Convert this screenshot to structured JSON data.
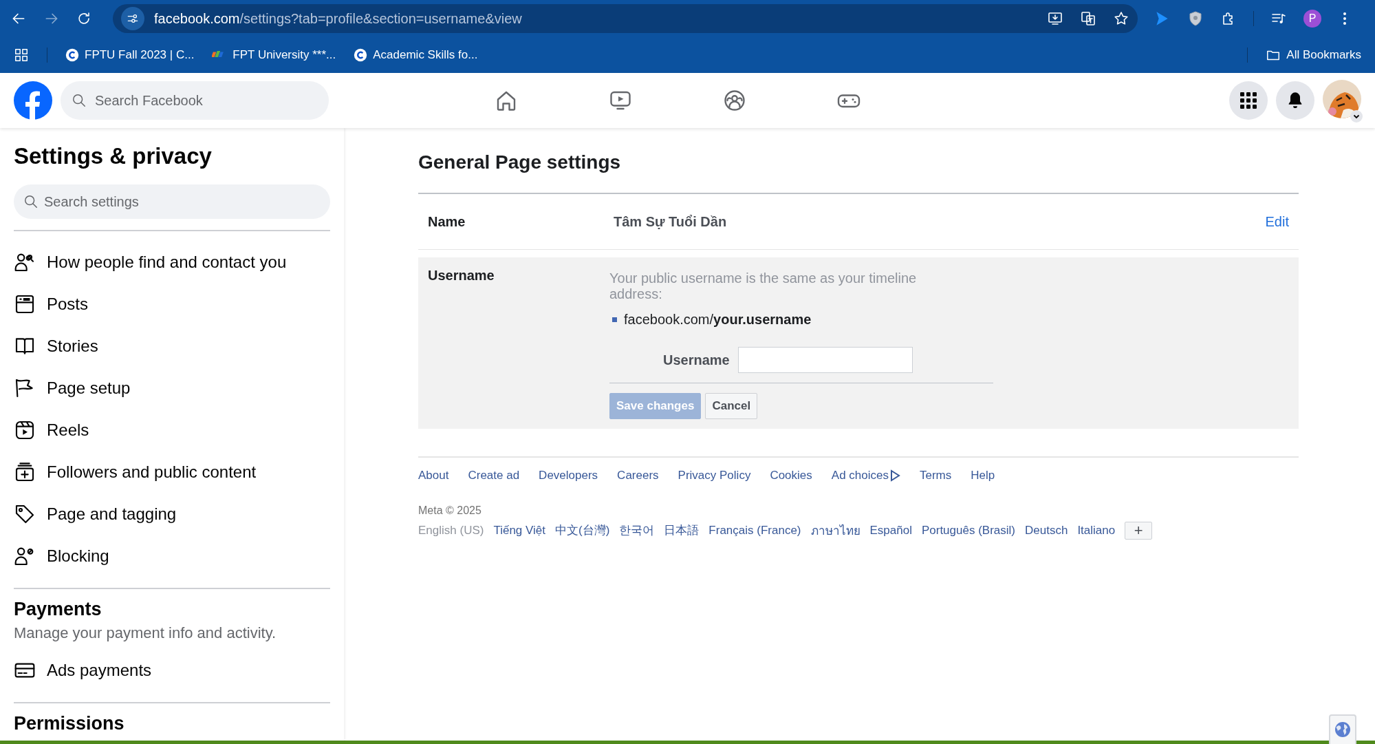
{
  "browser": {
    "url": {
      "domain": "facebook.com",
      "path": "/settings?tab=profile&section=username&view"
    },
    "bookmarks": [
      {
        "label": "FPTU Fall 2023 | C...",
        "kind": "c"
      },
      {
        "label": "FPT University ***...",
        "kind": "fpt"
      },
      {
        "label": "Academic Skills fo...",
        "kind": "c"
      }
    ],
    "all_bookmarks": "All Bookmarks",
    "profile_letter": "P"
  },
  "header": {
    "search": {
      "placeholder": "Search Facebook"
    }
  },
  "sidebar": {
    "title": "Settings & privacy",
    "search": {
      "placeholder": "Search settings"
    },
    "items": [
      {
        "label": "How people find and contact you",
        "kind": "people"
      },
      {
        "label": "Posts",
        "kind": "posts"
      },
      {
        "label": "Stories",
        "kind": "book"
      },
      {
        "label": "Page setup",
        "kind": "flag"
      },
      {
        "label": "Reels",
        "kind": "reels"
      },
      {
        "label": "Followers and public content",
        "kind": "followers"
      },
      {
        "label": "Page and tagging",
        "kind": "tag"
      },
      {
        "label": "Blocking",
        "kind": "block"
      }
    ],
    "sections": [
      {
        "title": "Payments",
        "description": "Manage your payment info and activity.",
        "items": [
          {
            "label": "Ads payments",
            "kind": "card"
          }
        ]
      },
      {
        "title": "Permissions"
      }
    ]
  },
  "main": {
    "title": "General Page settings",
    "name_row": {
      "label": "Name",
      "value": "Tâm Sự Tuổi Dần",
      "action": "Edit"
    },
    "username_row": {
      "label": "Username",
      "description": "Your public username is the same as your timeline address:",
      "example": "facebook.com/**your.username**",
      "field_label": "Username",
      "buttons": [
        {
          "label": "Save changes",
          "kind": "primary",
          "disabled": true
        },
        {
          "label": "Cancel",
          "kind": "secondary",
          "disabled": false
        }
      ]
    }
  },
  "footer": {
    "links": [
      {
        "label": "About",
        "kind": "text"
      },
      {
        "label": "Create ad",
        "kind": "text"
      },
      {
        "label": "Developers",
        "kind": "text"
      },
      {
        "label": "Careers",
        "kind": "text"
      },
      {
        "label": "Privacy Policy",
        "kind": "text"
      },
      {
        "label": "Cookies",
        "kind": "text"
      },
      {
        "label": "Ad choices",
        "kind": "adchoices"
      },
      {
        "label": "Terms",
        "kind": "text"
      },
      {
        "label": "Help",
        "kind": "text"
      }
    ],
    "copyright": "Meta © 2025",
    "languages": [
      {
        "label": "English (US)",
        "selected": true
      },
      {
        "label": "Tiếng Việt",
        "selected": false
      },
      {
        "label": "中文(台灣)",
        "selected": false
      },
      {
        "label": "한국어",
        "selected": false
      },
      {
        "label": "日本語",
        "selected": false
      },
      {
        "label": "Français (France)",
        "selected": false
      },
      {
        "label": "ภาษาไทย",
        "selected": false
      },
      {
        "label": "Español",
        "selected": false
      },
      {
        "label": "Português (Brasil)",
        "selected": false
      },
      {
        "label": "Deutsch",
        "selected": false
      },
      {
        "label": "Italiano",
        "selected": false
      }
    ],
    "more": "+"
  }
}
